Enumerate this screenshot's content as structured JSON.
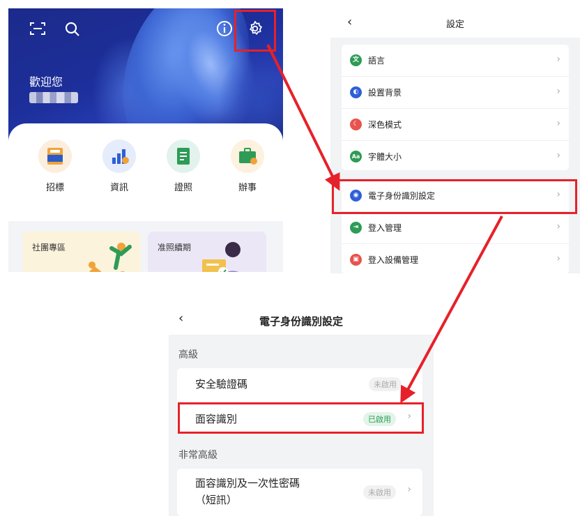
{
  "home": {
    "welcome": "歡迎您",
    "services": [
      {
        "label": "招標",
        "icon": "tender-icon"
      },
      {
        "label": "資訊",
        "icon": "info-chart-icon"
      },
      {
        "label": "證照",
        "icon": "license-icon"
      },
      {
        "label": "辦事",
        "icon": "briefcase-icon"
      }
    ],
    "promos": [
      {
        "label": "社團專區"
      },
      {
        "label": "准照續期"
      }
    ]
  },
  "settings": {
    "title": "設定",
    "items": [
      {
        "label": "語言",
        "color": "#2e9b56",
        "glyph": "文"
      },
      {
        "label": "設置背景",
        "color": "#2f5fd6",
        "glyph": "◐"
      },
      {
        "label": "深色模式",
        "color": "#e8534d",
        "glyph": "☾"
      },
      {
        "label": "字體大小",
        "color": "#2e9b56",
        "glyph": "Aa"
      },
      {
        "label": "電子身份識別設定",
        "color": "#2f5fd6",
        "glyph": "◉"
      },
      {
        "label": "登入管理",
        "color": "#2e9b56",
        "glyph": "⇥"
      },
      {
        "label": "登入設備管理",
        "color": "#e8534d",
        "glyph": "▣"
      }
    ]
  },
  "eid": {
    "title": "電子身份識別設定",
    "advanced_label": "高級",
    "very_advanced_label": "非常高級",
    "advanced_items": [
      {
        "label": "安全驗證碼",
        "status": "未啟用"
      },
      {
        "label": "面容識別",
        "status": "已啟用"
      }
    ],
    "very_advanced_items": [
      {
        "label_line1": "面容識別及一次性密碼",
        "label_line2": "（短訊）",
        "status": "未啟用"
      }
    ]
  },
  "colors": {
    "highlight": "#e62129",
    "enabled_green": "#2e9b56",
    "banner_blue": "#1d2f9b"
  }
}
